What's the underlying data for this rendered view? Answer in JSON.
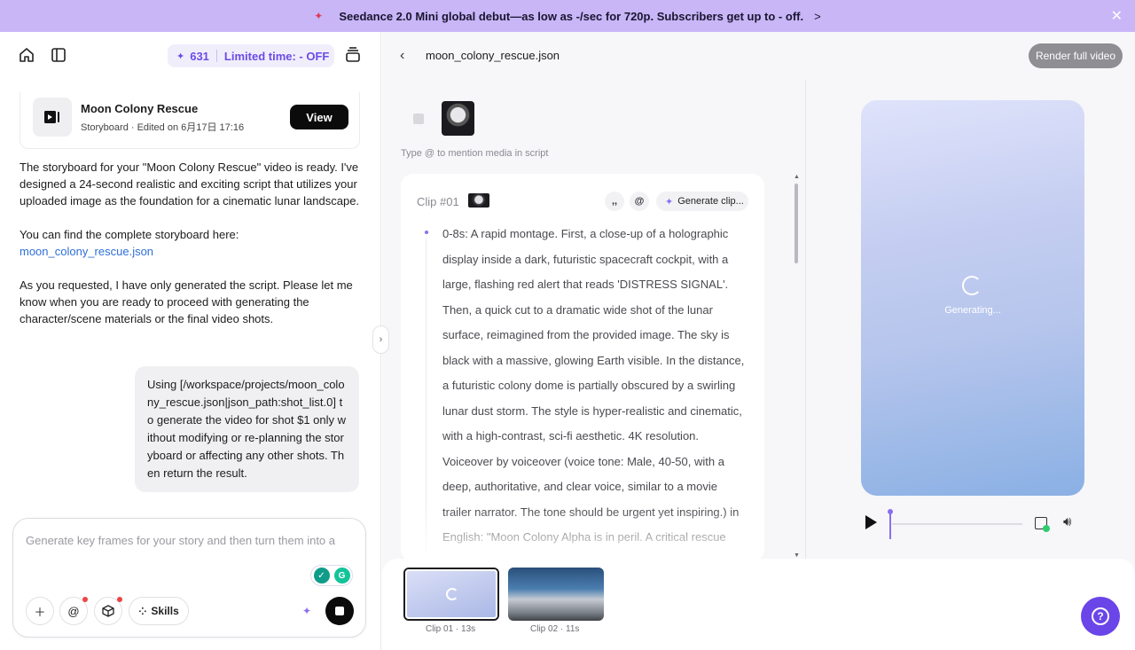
{
  "banner": {
    "text": "Seedance 2.0 Mini global debut—as low as -/sec for 720p. Subscribers get up to - off.",
    "chevron": ">",
    "close": "✕"
  },
  "topbar": {
    "credits_value": "631",
    "credits_promo": "Limited time: - OFF"
  },
  "project": {
    "title": "Moon Colony Rescue",
    "subtitle": "Storyboard · Edited on 6月17日 17:16",
    "view_label": "View"
  },
  "assistant": {
    "p1": "The storyboard for your \"Moon Colony Rescue\" video is ready. I've designed a 24-second realistic and exciting script that utilizes your uploaded image as the foundation for a cinematic lunar landscape.",
    "p2": "You can find the complete storyboard here:",
    "link": "moon_colony_rescue.json",
    "p3": "As you requested, I have only generated the script. Please let me know when you are ready to proceed with generating the character/scene materials or the final video shots."
  },
  "user_message": "Using [/workspace/projects/moon_colony_rescue.json|json_path:shot_list.0] to generate the video for shot $1 only without modifying or re-planning the storyboard or affecting any other shots. Then return the result.",
  "composer": {
    "placeholder": "Generate key frames for your story and then turn them into a",
    "skills_label": "Skills"
  },
  "editor": {
    "filename": "moon_colony_rescue.json",
    "render_label": "Render full video",
    "mention_hint": "Type @ to mention media in script",
    "clip_label": "Clip #01",
    "generate_clip_label": "Generate clip...",
    "clip_script": "0-8s: A rapid montage. First, a close-up of a holographic display inside a dark, futuristic spacecraft cockpit, with a large, flashing red alert that reads 'DISTRESS SIGNAL'. Then, a quick cut to a dramatic wide shot of the lunar surface, reimagined from the provided image. The sky is black with a massive, glowing Earth visible. In the distance, a futuristic colony dome is partially obscured by a swirling lunar dust storm. The style is hyper-realistic and cinematic, with a high-contrast, sci-fi aesthetic. 4K resolution. Voiceover by voiceover (voice tone: Male, 40-50, with a deep, authoritative, and clear voice, similar to a movie trailer narrator. The tone should be urgent yet inspiring.) in English: \"Moon Colony Alpha is in peril. A critical rescue"
  },
  "preview": {
    "status": "Generating..."
  },
  "timeline": {
    "clips": [
      {
        "label": "Clip 01 · 13s"
      },
      {
        "label": "Clip 02 · 11s"
      }
    ]
  },
  "colors": {
    "accent": "#6a45e8",
    "banner_bg": "#c8b6f7",
    "link": "#2f6fd8"
  }
}
